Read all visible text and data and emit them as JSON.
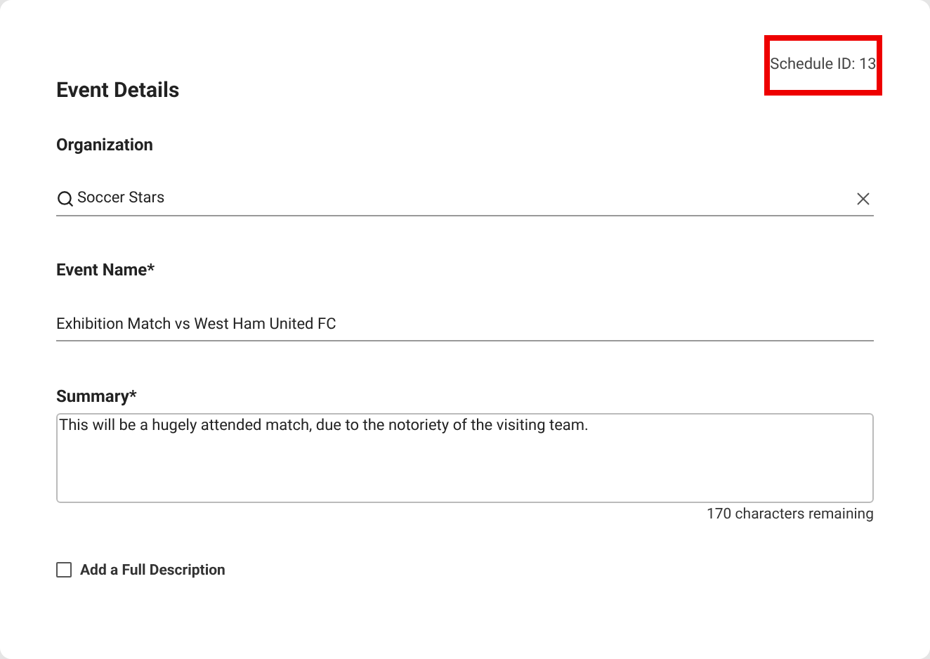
{
  "schedule_id": {
    "text": "Schedule ID: 13",
    "highlighted": true
  },
  "title": "Event Details",
  "organization": {
    "label": "Organization",
    "value": "Soccer Stars"
  },
  "event_name": {
    "label": "Event Name*",
    "value": "Exhibition Match vs West Ham United FC"
  },
  "summary": {
    "label": "Summary*",
    "value": "This will be a hugely attended match, due to the notoriety of the visiting team.",
    "remaining": "170 characters remaining"
  },
  "full_description": {
    "label": "Add a Full Description",
    "checked": false
  }
}
